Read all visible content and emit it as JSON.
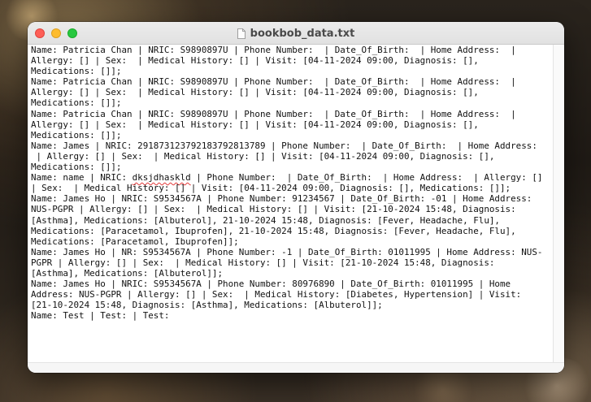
{
  "window": {
    "title": "bookbob_data.txt",
    "file_icon": "document-icon"
  },
  "editor": {
    "lines": [
      "Name: Patricia Chan | NRIC: S9890897U | Phone Number:  | Date_Of_Birth:  | Home Address:  |",
      "Allergy: [] | Sex:  | Medical History: [] | Visit: [04-11-2024 09:00, Diagnosis: [],",
      "Medications: []];",
      "Name: Patricia Chan | NRIC: S9890897U | Phone Number:  | Date_Of_Birth:  | Home Address:  |",
      "Allergy: [] | Sex:  | Medical History: [] | Visit: [04-11-2024 09:00, Diagnosis: [],",
      "Medications: []];",
      "Name: Patricia Chan | NRIC: S9890897U | Phone Number:  | Date_Of_Birth:  | Home Address:  |",
      "Allergy: [] | Sex:  | Medical History: [] | Visit: [04-11-2024 09:00, Diagnosis: [],",
      "Medications: []];",
      "Name: James | NRIC: 291873123792183792813789 | Phone Number:  | Date_Of_Birth:  | Home Address:",
      " | Allergy: [] | Sex:  | Medical History: [] | Visit: [04-11-2024 09:00, Diagnosis: [],",
      "Medications: []];",
      "Name: name | NRIC: dksjdhaskld | Phone Number:  | Date_Of_Birth:  | Home Address:  | Allergy: []",
      "| Sex:  | Medical History: [] | Visit: [04-11-2024 09:00, Diagnosis: [], Medications: []];",
      "Name: James Ho | NRIC: S9534567A | Phone Number: 91234567 | Date_Of_Birth: -01 | Home Address:",
      "NUS-PGPR | Allergy: [] | Sex:  | Medical History: [] | Visit: [21-10-2024 15:48, Diagnosis:",
      "[Asthma], Medications: [Albuterol], 21-10-2024 15:48, Diagnosis: [Fever, Headache, Flu],",
      "Medications: [Paracetamol, Ibuprofen], 21-10-2024 15:48, Diagnosis: [Fever, Headache, Flu],",
      "Medications: [Paracetamol, Ibuprofen]];",
      "Name: James Ho | NR: S9534567A | Phone Number: -1 | Date_Of_Birth: 01011995 | Home Address: NUS-",
      "PGPR | Allergy: [] | Sex:  | Medical History: [] | Visit: [21-10-2024 15:48, Diagnosis:",
      "[Asthma], Medications: [Albuterol]];",
      "Name: James Ho | NRIC: S9534567A | Phone Number: 80976890 | Date_Of_Birth: 01011995 | Home",
      "Address: NUS-PGPR | Allergy: [] | Sex:  | Medical History: [Diabetes, Hypertension] | Visit:",
      "[21-10-2024 15:48, Diagnosis: [Asthma], Medications: [Albuterol]];",
      "Name: Test | Test: | Test:"
    ],
    "spellcheck_word": "dksjdhaskld",
    "spellcheck_line": 12
  },
  "colors": {
    "close": "#fe5f57",
    "minimize": "#febc2e",
    "maximize": "#28c840",
    "spellcheck_underline": "#e23a3a"
  }
}
